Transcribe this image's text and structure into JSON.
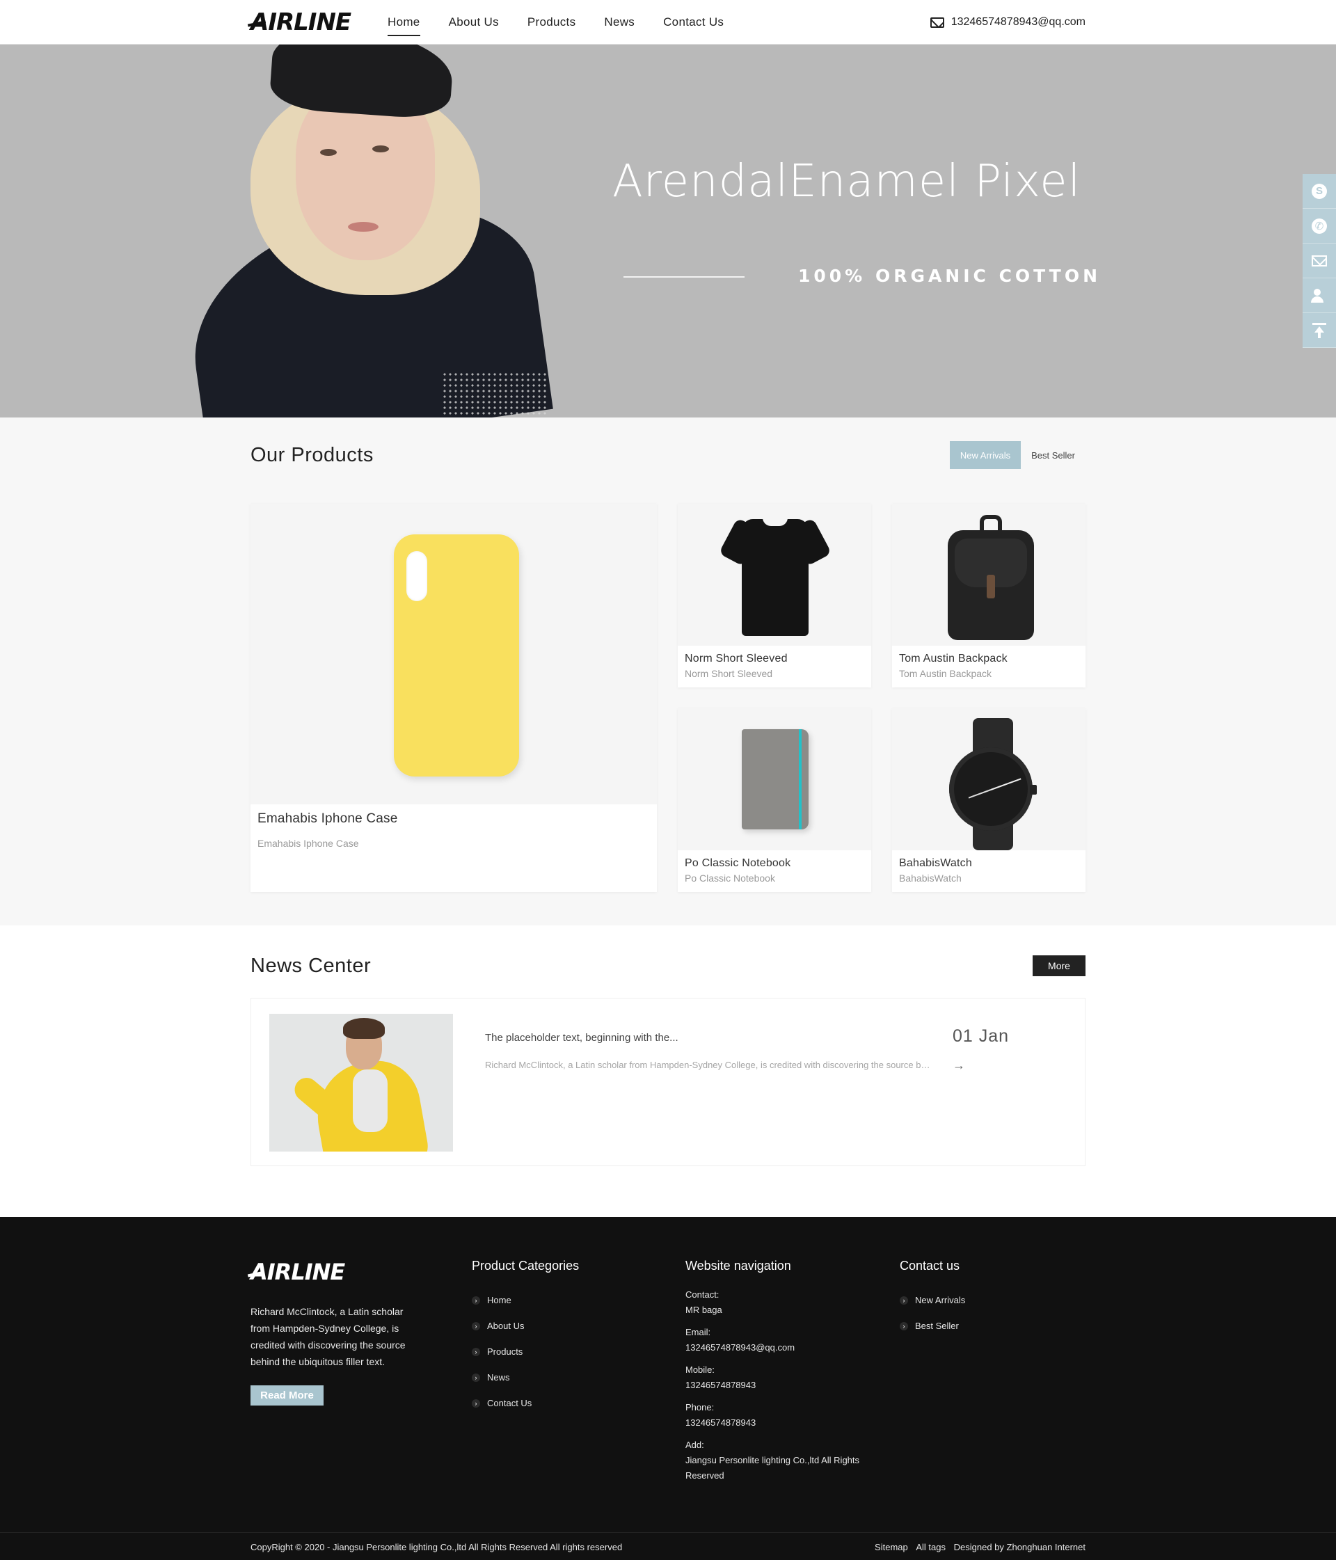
{
  "header": {
    "logo": "AIRLINE",
    "nav": [
      "Home",
      "About Us",
      "Products",
      "News",
      "Contact Us"
    ],
    "email": "13246574878943@qq.com"
  },
  "banner": {
    "title": "ArendalEnamel Pixel",
    "subtitle": "100% ORGANIC COTTON"
  },
  "sidebar": {
    "icons": [
      "skype-icon",
      "whatsapp-icon",
      "mail-icon",
      "user-icon",
      "back-to-top-icon"
    ]
  },
  "products": {
    "title": "Our Products",
    "tabs": [
      "New Arrivals",
      "Best Seller"
    ],
    "items": [
      {
        "name": "Emahabis Iphone Case",
        "desc": "Emahabis Iphone Case"
      },
      {
        "name": "Norm Short Sleeved",
        "desc": "Norm Short Sleeved"
      },
      {
        "name": "Tom Austin Backpack",
        "desc": "Tom Austin Backpack"
      },
      {
        "name": "Po Classic Notebook",
        "desc": "Po Classic Notebook"
      },
      {
        "name": "BahabisWatch",
        "desc": "BahabisWatch"
      }
    ]
  },
  "news": {
    "title": "News Center",
    "more": "More",
    "item": {
      "title": "The placeholder text, beginning with the...",
      "body": "Richard McClintock, a Latin scholar from Hampden-Sydney College, is credited with discovering the source behind the ubiquitous filler text.",
      "date": "01 Jan",
      "arrow": "→"
    }
  },
  "footer": {
    "logo": "AIRLINE",
    "about": "Richard McClintock, a Latin scholar from Hampden-Sydney College, is credited with discovering the source behind the ubiquitous filler text.",
    "read_more": "Read More",
    "categories_title": "Product Categories",
    "categories": [
      "Home",
      "About Us",
      "Products",
      "News",
      "Contact Us"
    ],
    "nav_title": "Website navigation",
    "contact_label": "Contact:",
    "contact_value": "MR baga",
    "email_label": "Email:",
    "email_value": "13246574878943@qq.com",
    "mobile_label": "Mobile:",
    "mobile_value": "13246574878943",
    "phone_label": "Phone:",
    "phone_value": "13246574878943",
    "add_label": "Add:",
    "add_value": "Jiangsu Personlite lighting Co.,ltd All Rights Reserved",
    "contactus_title": "Contact us",
    "contactus_links": [
      "New Arrivals",
      "Best Seller"
    ],
    "copyright": "CopyRight © 2020 -   Jiangsu Personlite lighting Co.,ltd All Rights Reserved  All rights reserved",
    "bottom_links": [
      "Sitemap",
      "All tags",
      "Designed by Zhonghuan Internet"
    ]
  }
}
